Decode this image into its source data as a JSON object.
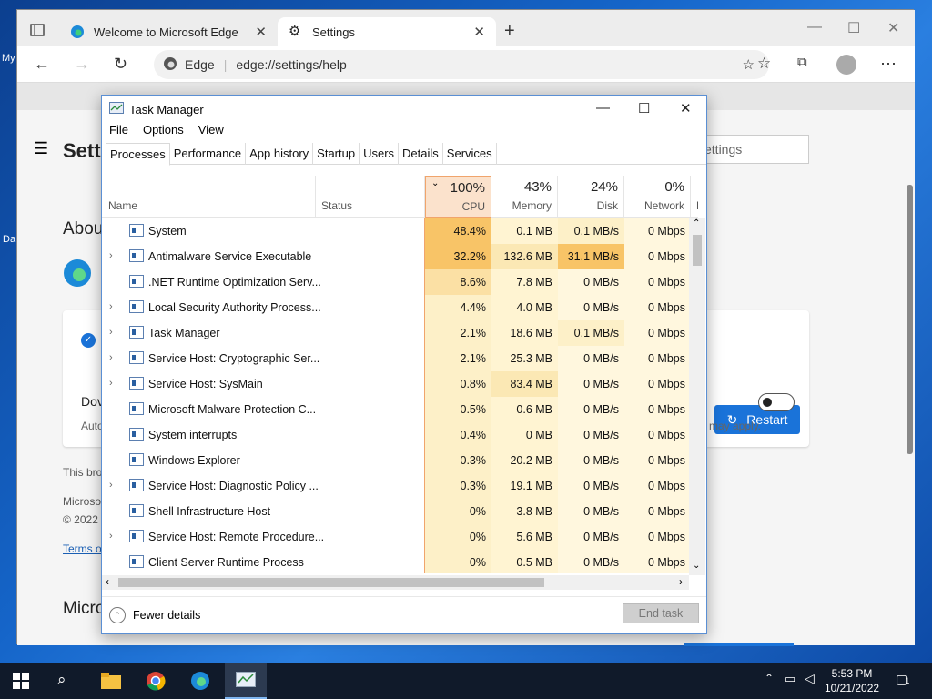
{
  "browser": {
    "tabs": [
      {
        "label": "Welcome to Microsoft Edge"
      },
      {
        "label": "Settings"
      }
    ],
    "url_prefix": "Edge",
    "url": "edge://settings/help"
  },
  "settings": {
    "title": "Sett",
    "about": "Abou",
    "search_placeholder": "ettings",
    "restart_label": "Restart",
    "dow": "Dov",
    "auto": "Auto",
    "rates": "es may apply.",
    "this_bro": "This bro",
    "microso": "Microso",
    "copy": "© 2022",
    "terms": "Terms of",
    "micro2": "Micro"
  },
  "desktop": {
    "my": "My",
    "da": "Da"
  },
  "taskmanager": {
    "title": "Task Manager",
    "menu": [
      "File",
      "Options",
      "View"
    ],
    "tabs": [
      "Processes",
      "Performance",
      "App history",
      "Startup",
      "Users",
      "Details",
      "Services"
    ],
    "columns": {
      "name": "Name",
      "status": "Status",
      "cpu_pct": "100%",
      "cpu": "CPU",
      "mem_pct": "43%",
      "memory": "Memory",
      "disk_pct": "24%",
      "disk": "Disk",
      "net_pct": "0%",
      "network": "Network",
      "power": "P"
    },
    "processes": [
      {
        "name": "System",
        "cpu": "48.4%",
        "mem": "0.1 MB",
        "disk": "0.1 MB/s",
        "net": "0 Mbps",
        "exp": false
      },
      {
        "name": "Antimalware Service Executable",
        "cpu": "32.2%",
        "mem": "132.6 MB",
        "disk": "31.1 MB/s",
        "net": "0 Mbps",
        "exp": true
      },
      {
        "name": ".NET Runtime Optimization Serv...",
        "cpu": "8.6%",
        "mem": "7.8 MB",
        "disk": "0 MB/s",
        "net": "0 Mbps",
        "exp": false
      },
      {
        "name": "Local Security Authority Process...",
        "cpu": "4.4%",
        "mem": "4.0 MB",
        "disk": "0 MB/s",
        "net": "0 Mbps",
        "exp": true
      },
      {
        "name": "Task Manager",
        "cpu": "2.1%",
        "mem": "18.6 MB",
        "disk": "0.1 MB/s",
        "net": "0 Mbps",
        "exp": true
      },
      {
        "name": "Service Host: Cryptographic Ser...",
        "cpu": "2.1%",
        "mem": "25.3 MB",
        "disk": "0 MB/s",
        "net": "0 Mbps",
        "exp": true
      },
      {
        "name": "Service Host: SysMain",
        "cpu": "0.8%",
        "mem": "83.4 MB",
        "disk": "0 MB/s",
        "net": "0 Mbps",
        "exp": true
      },
      {
        "name": "Microsoft Malware Protection C...",
        "cpu": "0.5%",
        "mem": "0.6 MB",
        "disk": "0 MB/s",
        "net": "0 Mbps",
        "exp": false
      },
      {
        "name": "System interrupts",
        "cpu": "0.4%",
        "mem": "0 MB",
        "disk": "0 MB/s",
        "net": "0 Mbps",
        "exp": false
      },
      {
        "name": "Windows Explorer",
        "cpu": "0.3%",
        "mem": "20.2 MB",
        "disk": "0 MB/s",
        "net": "0 Mbps",
        "exp": false
      },
      {
        "name": "Service Host: Diagnostic Policy ...",
        "cpu": "0.3%",
        "mem": "19.1 MB",
        "disk": "0 MB/s",
        "net": "0 Mbps",
        "exp": true
      },
      {
        "name": "Shell Infrastructure Host",
        "cpu": "0%",
        "mem": "3.8 MB",
        "disk": "0 MB/s",
        "net": "0 Mbps",
        "exp": false
      },
      {
        "name": "Service Host: Remote Procedure...",
        "cpu": "0%",
        "mem": "5.6 MB",
        "disk": "0 MB/s",
        "net": "0 Mbps",
        "exp": true
      },
      {
        "name": "Client Server Runtime Process",
        "cpu": "0%",
        "mem": "0.5 MB",
        "disk": "0 MB/s",
        "net": "0 Mbps",
        "exp": false
      }
    ],
    "fewer_details": "Fewer details",
    "end_task": "End task"
  },
  "taskbar": {
    "time": "5:53 PM",
    "date": "10/21/2022",
    "notif_count": "1"
  }
}
